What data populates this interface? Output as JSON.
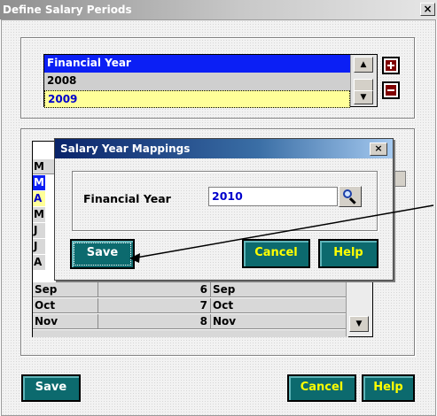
{
  "window": {
    "title": "Define Salary Periods",
    "close_label": "×"
  },
  "financial_year_list": {
    "header": "Financial Year",
    "items": [
      "2008",
      "2009"
    ],
    "selected": "2009"
  },
  "grid": {
    "rows": [
      {
        "month": "Sep",
        "period": "6",
        "mapped_month": "Sep"
      },
      {
        "month": "Oct",
        "period": "7",
        "mapped_month": "Oct"
      },
      {
        "month": "Nov",
        "period": "8",
        "mapped_month": "Nov"
      }
    ],
    "partial_letters": [
      "M",
      "M",
      "A",
      "M",
      "J",
      "J",
      "A"
    ]
  },
  "dialog": {
    "title": "Salary Year Mappings",
    "close_label": "×",
    "field_label": "Financial Year",
    "field_value": "2010",
    "buttons": {
      "save": "Save",
      "cancel": "Cancel",
      "help": "Help"
    }
  },
  "footer_buttons": {
    "save": "Save",
    "cancel": "Cancel",
    "help": "Help"
  },
  "colors": {
    "list_header": "#0b1ff5",
    "selected_row": "#ffff99",
    "button_teal": "#0c6a6e",
    "dialog_title": "#0a246a"
  },
  "icons": {
    "add": "plus-icon",
    "remove": "minus-icon",
    "lookup": "magnifier-icon"
  }
}
